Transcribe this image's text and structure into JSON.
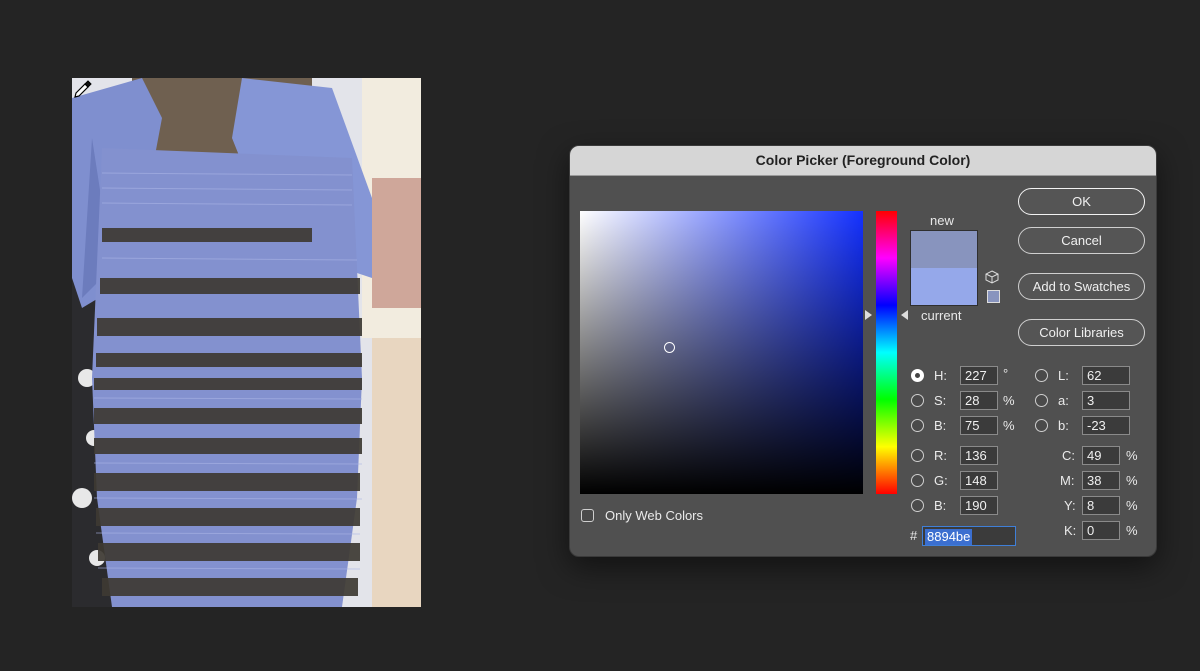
{
  "dialog": {
    "title": "Color Picker (Foreground Color)",
    "buttons": {
      "ok": "OK",
      "cancel": "Cancel",
      "add_to_swatches": "Add to Swatches",
      "color_libraries": "Color Libraries"
    },
    "swatch": {
      "new_label": "new",
      "current_label": "current",
      "new_color": "#8894be",
      "current_color": "#95a8ea"
    },
    "only_web_colors_label": "Only Web Colors",
    "hsb": {
      "h": {
        "label": "H:",
        "value": "227",
        "unit": "°",
        "selected": true
      },
      "s": {
        "label": "S:",
        "value": "28",
        "unit": "%"
      },
      "b": {
        "label": "B:",
        "value": "75",
        "unit": "%"
      }
    },
    "rgb": {
      "r": {
        "label": "R:",
        "value": "136"
      },
      "g": {
        "label": "G:",
        "value": "148"
      },
      "b": {
        "label": "B:",
        "value": "190"
      }
    },
    "lab": {
      "l": {
        "label": "L:",
        "value": "62"
      },
      "a": {
        "label": "a:",
        "value": "3"
      },
      "b": {
        "label": "b:",
        "value": "-23"
      }
    },
    "cmyk": {
      "c": {
        "label": "C:",
        "value": "49",
        "unit": "%"
      },
      "m": {
        "label": "M:",
        "value": "38",
        "unit": "%"
      },
      "y": {
        "label": "Y:",
        "value": "8",
        "unit": "%"
      },
      "k": {
        "label": "K:",
        "value": "0",
        "unit": "%"
      }
    },
    "hex": {
      "label": "#",
      "value": "8894be"
    },
    "hue_base_color": "#1431ff"
  },
  "colors": {
    "background": "#242424",
    "dress_blue": "#8391cf",
    "lace_dark": "#3e3a33"
  }
}
